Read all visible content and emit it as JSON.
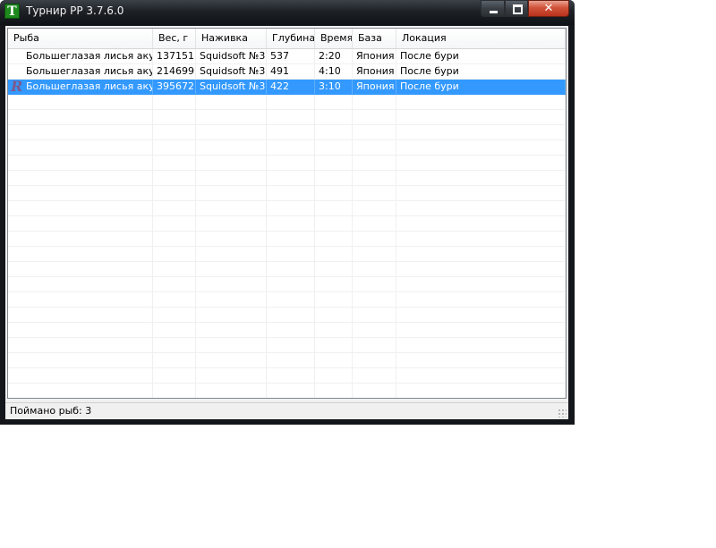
{
  "window": {
    "title": "Турнир РР 3.7.6.0",
    "icon_letter": "T",
    "close_glyph": "✕"
  },
  "columns": [
    "Рыба",
    "Вес, г",
    "Наживка",
    "Глубина",
    "Время",
    "База",
    "Локация"
  ],
  "rows": [
    {
      "fish": "Большеглазая лисья акула",
      "weight": "137151",
      "bait": "Squidsoft №3",
      "depth": "537",
      "time": "2:20",
      "base": "Япония",
      "location": "После бури",
      "selected": false,
      "icon": ""
    },
    {
      "fish": "Большеглазая лисья акула",
      "weight": "214699",
      "bait": "Squidsoft №3",
      "depth": "491",
      "time": "4:10",
      "base": "Япония",
      "location": "После бури",
      "selected": false,
      "icon": ""
    },
    {
      "fish": "Большеглазая лисья акула",
      "weight": "395672",
      "bait": "Squidsoft №3",
      "depth": "422",
      "time": "3:10",
      "base": "Япония",
      "location": "После бури",
      "selected": true,
      "icon": "R"
    }
  ],
  "status": {
    "text": "Поймано рыб: 3"
  },
  "colors": {
    "selection": "#3399ff",
    "title_bar": "#1e2227",
    "record_icon": "#7c5a8f"
  }
}
